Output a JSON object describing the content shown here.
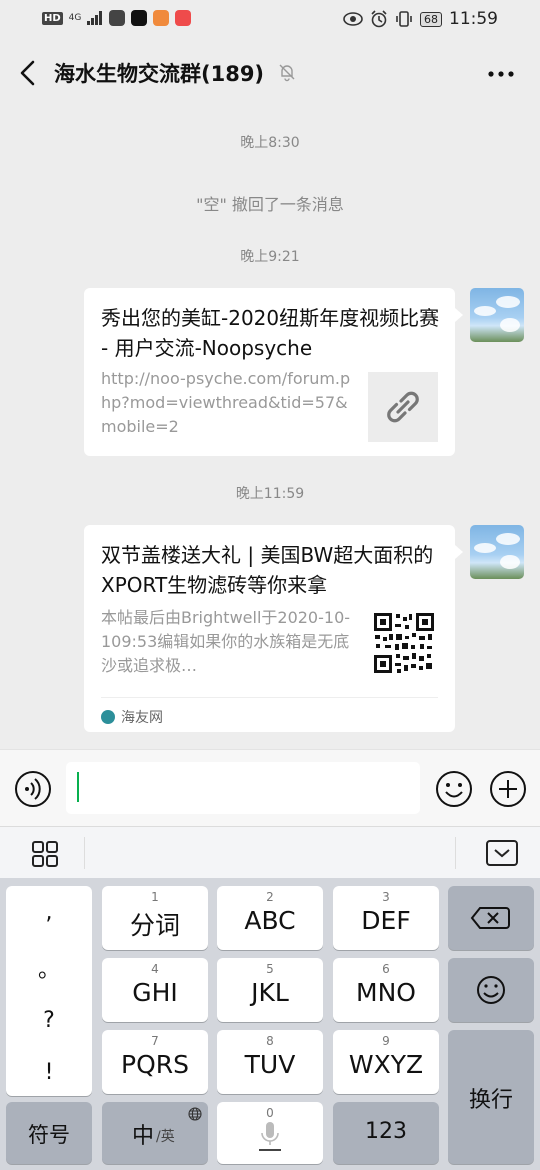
{
  "status_bar": {
    "hd": "HD",
    "signal": "4G",
    "battery": "68",
    "time": "11:59"
  },
  "header": {
    "title": "海水生物交流群(189)"
  },
  "chat": {
    "time1": "晚上8:30",
    "recall": "\"空\" 撤回了一条消息",
    "time2": "晚上9:21",
    "msg1": {
      "title": "秀出您的美缸-2020纽斯年度视频比赛 - 用户交流-Noopsyche",
      "desc": "http://noo-psyche.com/forum.php?mod=viewthread&tid=57&mobile=2"
    },
    "time3": "晚上11:59",
    "msg2": {
      "title": "双节盖楼送大礼 | 美国BW超大面积的XPORT生物滤砖等你来拿",
      "desc": "本帖最后由Brightwell于2020-10-109:53编辑如果你的水族箱是无底沙或追求极…",
      "source": "海友网"
    }
  },
  "keyboard": {
    "punct": [
      ",",
      "。",
      "?",
      "!"
    ],
    "keys": [
      {
        "num": "1",
        "label": "分词"
      },
      {
        "num": "2",
        "label": "ABC"
      },
      {
        "num": "3",
        "label": "DEF"
      },
      {
        "num": "4",
        "label": "GHI"
      },
      {
        "num": "5",
        "label": "JKL"
      },
      {
        "num": "6",
        "label": "MNO"
      },
      {
        "num": "7",
        "label": "PQRS"
      },
      {
        "num": "8",
        "label": "TUV"
      },
      {
        "num": "9",
        "label": "WXYZ"
      }
    ],
    "symbols": "符号",
    "lang_main": "中",
    "lang_sub": "/英",
    "space_num": "0",
    "digits": "123",
    "enter": "换行"
  },
  "colors": {
    "background": "#ededed",
    "bubble": "#ffffff",
    "caret": "#08b04f",
    "keyboard_bg": "#d3d6dc",
    "dark_key": "#abb1bb"
  }
}
